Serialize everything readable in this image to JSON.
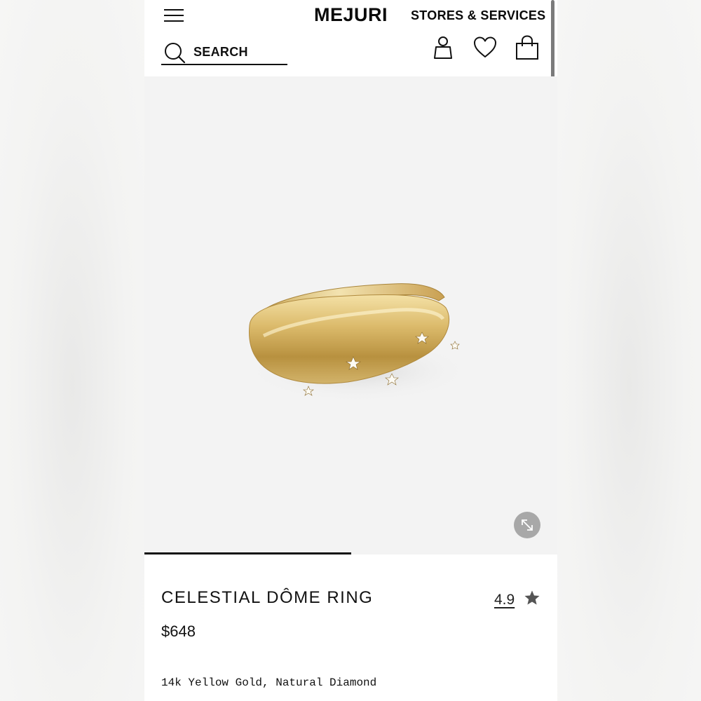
{
  "header": {
    "logo": "MEJURI",
    "stores_link": "STORES & SERVICES",
    "search": {
      "placeholder": "SEARCH",
      "value": ""
    },
    "icons": [
      "menu-icon",
      "search-icon",
      "account-icon",
      "heart-icon",
      "shopping-bag-icon"
    ]
  },
  "gallery": {
    "image": "gold dome ring with star-set diamonds",
    "progress": 0.5,
    "expand_icon": "expand-icon"
  },
  "product": {
    "title": "CELESTIAL DÔME RING",
    "rating": "4.9",
    "rating_icon": "star-icon",
    "price": "$648",
    "materials": "14k Yellow Gold, Natural Diamond"
  },
  "colors": {
    "text": "#111111",
    "gallery_bg": "#f3f3f3",
    "gold": "#d9b867",
    "star": "#555555",
    "expand_button": "#a8a8a8"
  }
}
